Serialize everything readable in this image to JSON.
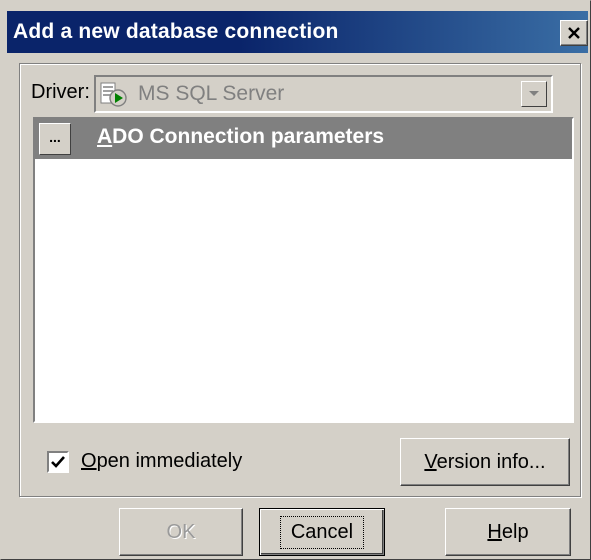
{
  "window": {
    "title": "Add a new database connection",
    "close_label": "×"
  },
  "driver": {
    "label": "Driver:",
    "value": "MS SQL Server"
  },
  "params": {
    "ellipsis_label": "...",
    "title_prefix": "A",
    "title_rest": "DO Connection parameters"
  },
  "options": {
    "open_immediately_underlined": "O",
    "open_immediately_rest": "pen immediately",
    "open_immediately_checked": true
  },
  "buttons": {
    "version_underlined": "V",
    "version_rest": "ersion info...",
    "ok": "OK",
    "cancel": "Cancel",
    "help_underlined": "H",
    "help_rest": "elp"
  },
  "colors": {
    "titlebar": "#0a246a",
    "face": "#d4d0c8",
    "header": "#808080"
  }
}
